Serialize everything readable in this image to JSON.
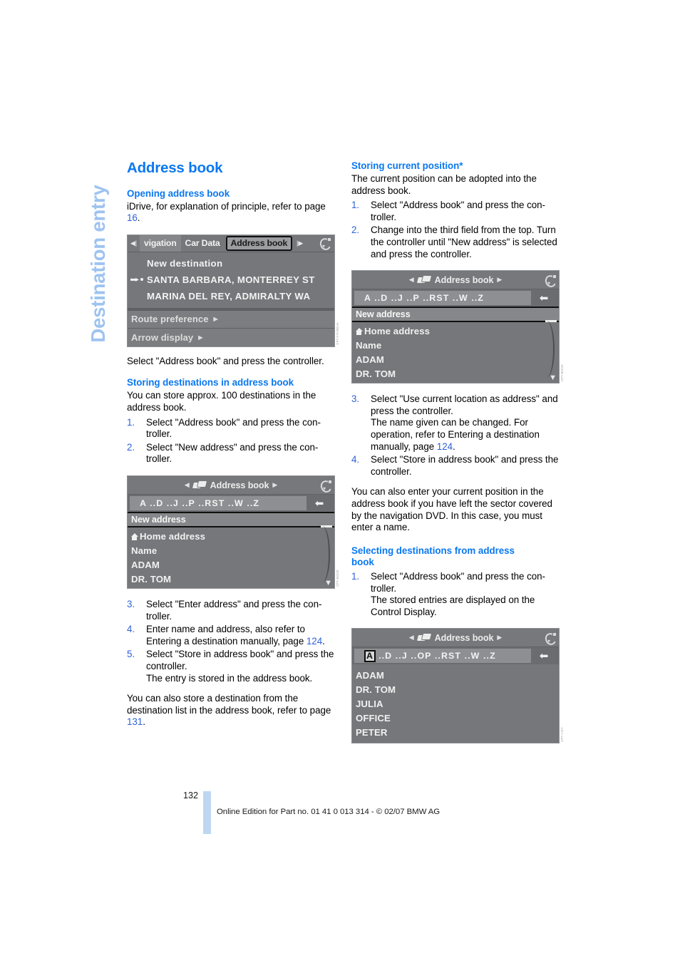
{
  "side_tab": {
    "label": "Destination entry"
  },
  "page": {
    "number": "132",
    "footer": "Online Edition for Part no. 01 41 0 013 314 - © 02/07 BMW AG"
  },
  "colors": {
    "heading_blue": "#0a78f0",
    "link_blue": "#2f62d8",
    "side_tab_blue": "#9ec3f0",
    "footer_bar_blue": "#bdd7f2"
  },
  "left_column": {
    "title": "Address book",
    "section_opening": {
      "heading": "Opening address book",
      "paragraph_1": "iDrive, for explanation of principle, refer to",
      "paragraph_1_tail": "page ",
      "page_ref": "16",
      "paragraph_1_end": ".",
      "caption": "Select \"Address book\" and press the controller."
    },
    "figure_1": {
      "tab_prev_icon": "◀|",
      "tab_next_icon": "|▶",
      "tabs": [
        {
          "label": "vigation",
          "state": "partial"
        },
        {
          "label": "Car Data",
          "state": "normal"
        },
        {
          "label": "Address book",
          "state": "selected"
        }
      ],
      "list": [
        "New destination",
        "SANTA BARBARA, MONTERREY ST",
        "MARINA DEL REY, ADMIRALTY WA"
      ],
      "options": [
        "Route preference",
        "Arrow display"
      ],
      "id_code": "CPT-FIT/REVA"
    },
    "section_storing": {
      "heading": "Storing destinations in address book",
      "intro": "You can store approx. 100 destinations in the address book.",
      "steps": [
        {
          "num": "1.",
          "text": "Select \"Address book\" and press the con-troller."
        },
        {
          "num": "2.",
          "text": "Select \"New address\" and press the con-troller."
        }
      ],
      "steps_after": [
        {
          "num": "3.",
          "text": "Select \"Enter address\" and press the con-troller."
        },
        {
          "num": "4.",
          "text": "Enter name and address, also refer to Entering a destination manually, page ",
          "page_ref": "124",
          "tail": "."
        },
        {
          "num": "5.",
          "text": "Select \"Store in address book\" and press the controller.",
          "text2": "The entry is stored in the address book."
        }
      ],
      "closing": "You can also store a destination from the destination list in the address book, refer to page ",
      "closing_page_ref": "131",
      "closing_tail": "."
    },
    "figure_2": {
      "header_title": "Address book",
      "alphabet": "A ..D ..J ..P ..RST ..W ..Z",
      "back_icon": "⬅",
      "selected_row": "New address",
      "rows": [
        "Home address",
        "Name",
        "ADAM",
        "DR. TOM"
      ],
      "id_code": "CPT-BOOK"
    }
  },
  "right_column": {
    "section_current_position": {
      "heading": "Storing current position*",
      "intro": "The current position can be adopted into the address book.",
      "steps": [
        {
          "num": "1.",
          "text": "Select \"Address book\" and press the con-troller."
        },
        {
          "num": "2.",
          "text": "Change into the third field from the top. Turn the controller until \"New address\" is selected and press the controller."
        }
      ],
      "steps_after": [
        {
          "num": "3.",
          "text": "Select \"Use current location as address\" and press the controller.",
          "text2": "The name given can be changed. For operation, refer to Entering a destination manually, page ",
          "page_ref": "124",
          "tail": "."
        },
        {
          "num": "4.",
          "text": "Select \"Store in address book\" and press the controller."
        }
      ],
      "closing": "You can also enter your current position in the address book if you have left the sector covered by the navigation DVD. In this case, you must enter a name."
    },
    "figure_3": {
      "header_title": "Address book",
      "alphabet": "A ..D ..J ..P ..RST ..W ..Z",
      "back_icon": "⬅",
      "selected_row": "New address",
      "rows": [
        "Home address",
        "Name",
        "ADAM",
        "DR. TOM"
      ],
      "id_code": "CPT-BOOK"
    },
    "section_selecting": {
      "heading_line1": "Selecting destinations from address",
      "heading_line2": "book",
      "steps": [
        {
          "num": "1.",
          "text": "Select \"Address book\" and press the con-troller.",
          "text2": "The stored entries are displayed on the Control Display."
        }
      ]
    },
    "figure_4": {
      "header_title": "Address book",
      "alphabet_selected": "A",
      "alphabet_rest": "..D ..J ..OP ..RST ..W ..Z",
      "back_icon": "⬅",
      "rows": [
        "ADAM",
        "DR. TOM",
        "JULIA",
        "OFFICE",
        "PETER"
      ],
      "id_code": "CPT-LIST"
    }
  }
}
